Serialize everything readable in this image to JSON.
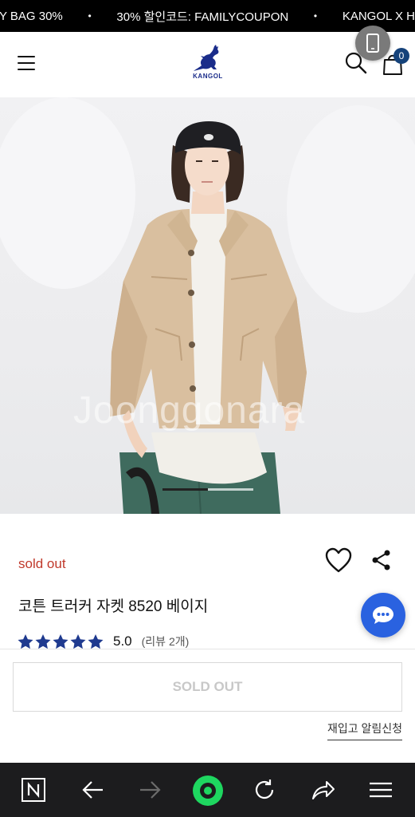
{
  "marquee": {
    "items": [
      "Y BAG 30%",
      "30% 할인코드: FAMILYCOUPON",
      "KANGOL X H"
    ],
    "separator": "•"
  },
  "header": {
    "logo_text": "KANGOL",
    "cart_count": "0",
    "brand_color": "#1a2c8a"
  },
  "hero": {
    "watermark": "Joonggonara",
    "slide_position": 0.5
  },
  "product": {
    "status": "sold out",
    "title": "코튼 트러커 자켓 8520 베이지",
    "rating": "5.0",
    "stars": 5,
    "review_count": "(리뷰 2개)"
  },
  "actions": {
    "soldout_label": "SOLD OUT",
    "restock_label": "재입고 알림신청"
  },
  "colors": {
    "status": "#c0392b",
    "star": "#1f3a8f",
    "chat": "#2a62e0",
    "browser_bar": "#1c1c1e",
    "browser_accent": "#1ed760"
  }
}
